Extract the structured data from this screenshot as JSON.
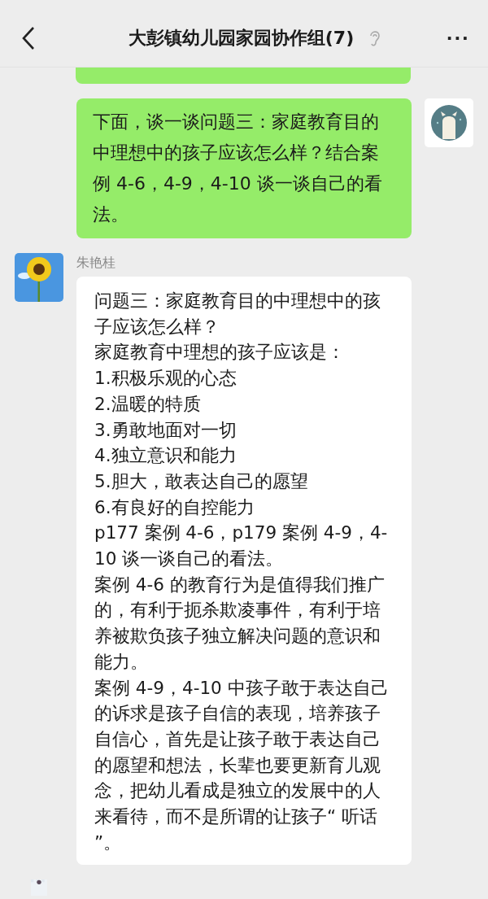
{
  "header": {
    "title": "大彭镇幼儿园家园协作组(7)",
    "more": "···"
  },
  "messages": [
    {
      "kind": "outgoing"
    },
    {
      "kind": "outgoing",
      "paragraphs": [
        "下面，谈一谈问题三：家庭教育目的中理想中的孩子应该怎么样？结合案例 4-6，4-9，4-10 谈一谈自己的看法。"
      ]
    },
    {
      "kind": "incoming",
      "sender": "朱艳桂",
      "paragraphs": [
        "问题三：家庭教育目的中理想中的孩子应该怎么样？",
        "家庭教育中理想的孩子应该是：",
        "1.积极乐观的心态",
        "2.温暖的特质",
        "3.勇敢地面对一切",
        "4.独立意识和能力",
        "5.胆大，敢表达自己的愿望",
        "6.有良好的自控能力",
        "p177 案例 4-6，p179 案例 4-9，4-10 谈一谈自己的看法。",
        "案例 4-6 的教育行为是值得我们推广的，有利于扼杀欺凌事件，有利于培养被欺负孩子独立解决问题的意识和能力。",
        "案例 4-9，4-10 中孩子敢于表达自己的诉求是孩子自信的表现，培养孩子自信心，首先是让孩子敢于表达自己的愿望和想法，长辈也要更新育儿观念，把幼儿看成是独立的发展中的人来看待，而不是所谓的让孩子“ 听话 ”。"
      ]
    },
    {
      "kind": "incoming"
    }
  ]
}
